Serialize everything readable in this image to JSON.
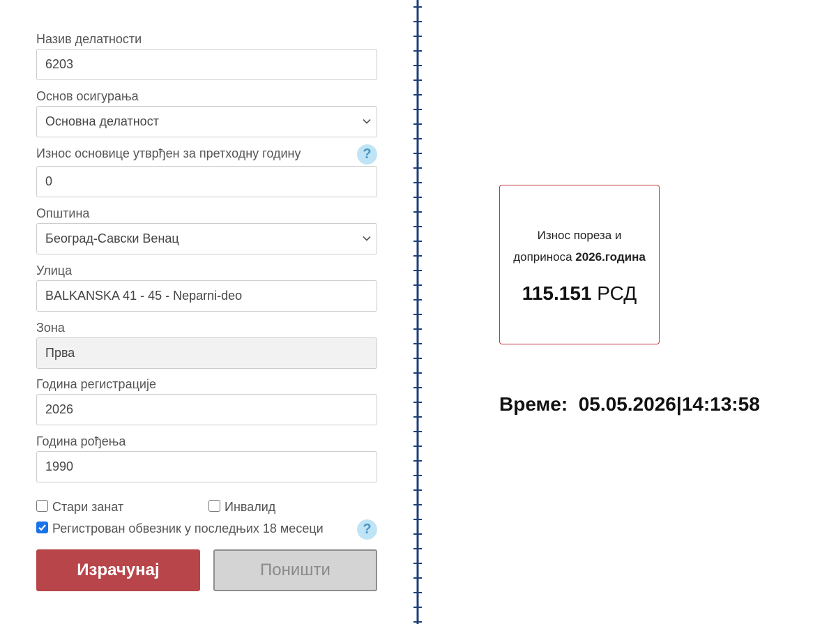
{
  "form": {
    "activity": {
      "label": "Назив делатности",
      "value": "6203"
    },
    "insurance_basis": {
      "label": "Основ осигурања",
      "value": "Основна делатност"
    },
    "base_amount": {
      "label": "Износ основице утврђен за претходну годину",
      "value": "0",
      "help": "?"
    },
    "municipality": {
      "label": "Општина",
      "value": "Београд-Савски Венац"
    },
    "street": {
      "label": "Улица",
      "value": "BALKANSKA 41 - 45 - Neparni-deo"
    },
    "zone": {
      "label": "Зона",
      "value": "Прва"
    },
    "registration_year": {
      "label": "Година регистрације",
      "value": "2026"
    },
    "birth_year": {
      "label": "Година рођења",
      "value": "1990"
    },
    "old_craft": {
      "label": "Стари занат",
      "checked": false
    },
    "disabled": {
      "label": "Инвалид",
      "checked": false
    },
    "registered_18": {
      "label": "Регистрован обвезник у последњих 18 месеци",
      "checked": true,
      "help": "?"
    },
    "calculate_label": "Израчунај",
    "reset_label": "Поништи"
  },
  "result": {
    "line1": "Износ пореза и",
    "line2_prefix": "доприноса ",
    "line2_bold": "2026.година",
    "amount_value": "115.151",
    "amount_currency": " РСД"
  },
  "time": {
    "label": "Време:",
    "date": "05.05.2026",
    "separator": "|",
    "clock": "14:13:58"
  },
  "colors": {
    "primary": "#b8454a",
    "divider": "#1f3f7a",
    "help_bg": "#bfe4f6",
    "checkbox": "#1a73e8"
  }
}
